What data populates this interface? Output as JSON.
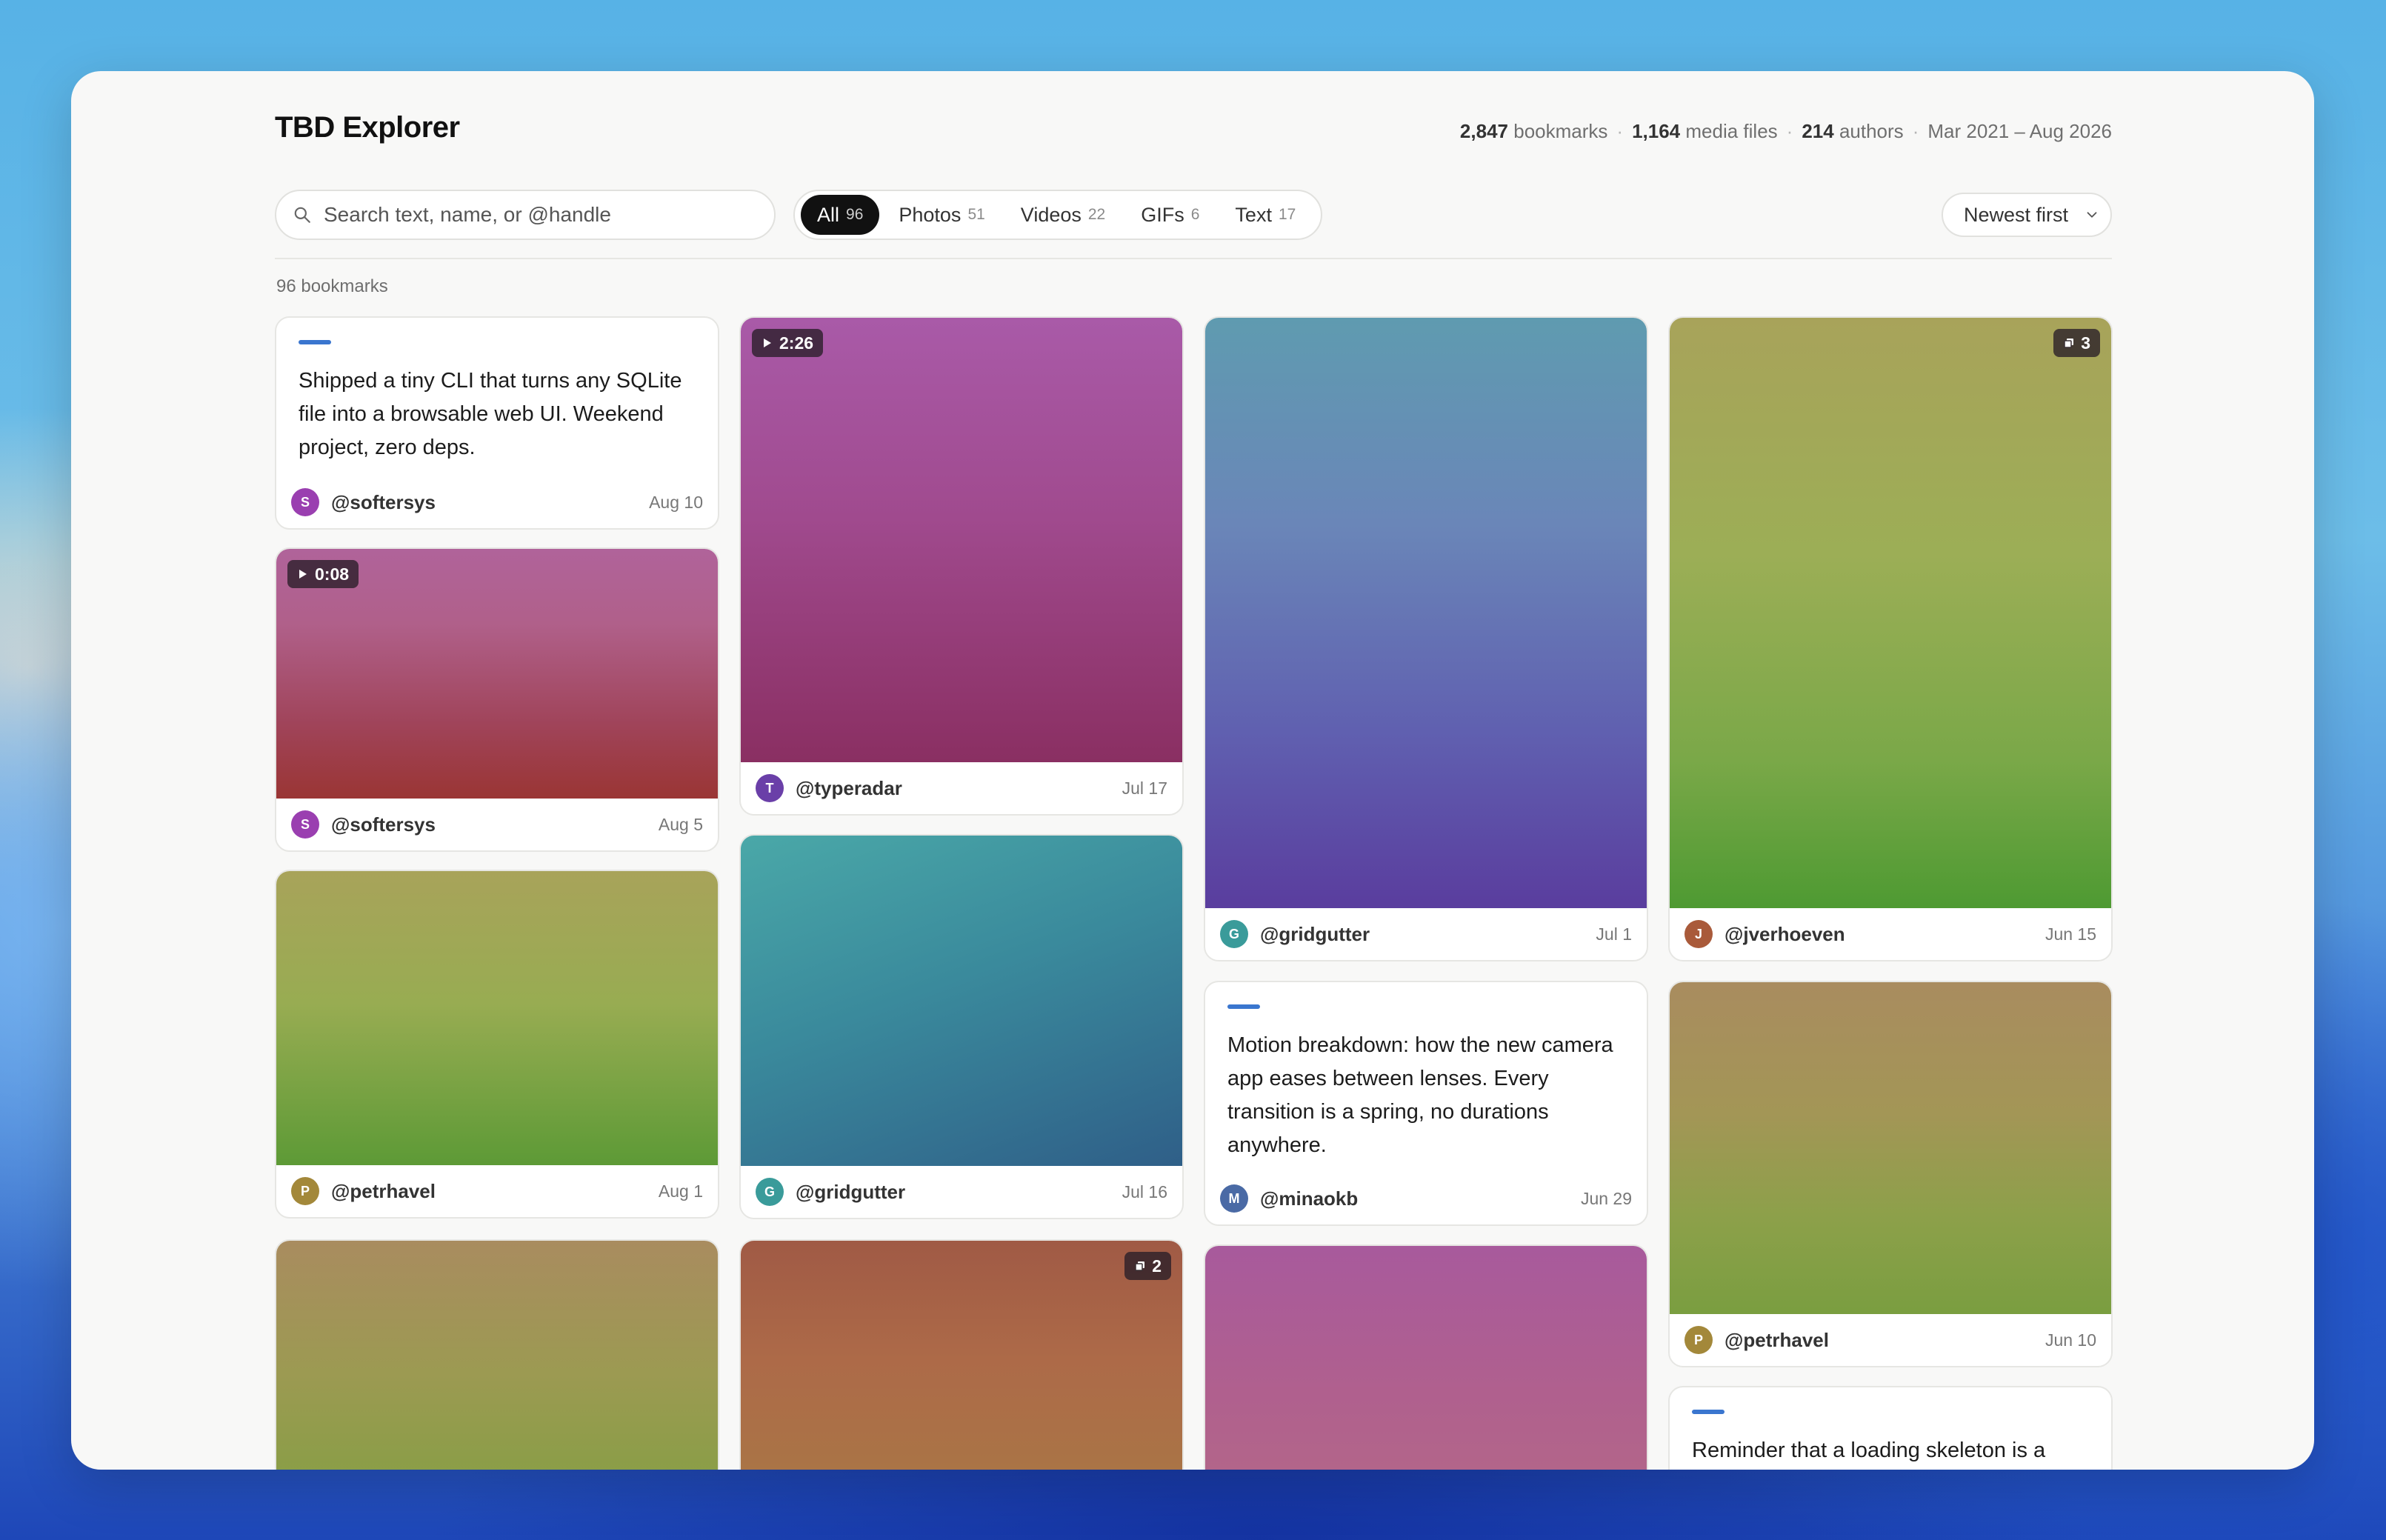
{
  "app": {
    "title": "TBD Explorer"
  },
  "stats": {
    "bookmarks_num": "2,847",
    "bookmarks_label": "bookmarks",
    "media_num": "1,164",
    "media_label": "media files",
    "authors_num": "214",
    "authors_label": "authors",
    "range": "Mar 2021 – Aug 2026",
    "separator": "·"
  },
  "search": {
    "placeholder": "Search text, name, or @handle",
    "icon": "search-icon"
  },
  "filters": [
    {
      "label": "All",
      "count": "96",
      "active": true
    },
    {
      "label": "Photos",
      "count": "51",
      "active": false
    },
    {
      "label": "Videos",
      "count": "22",
      "active": false
    },
    {
      "label": "GIFs",
      "count": "6",
      "active": false
    },
    {
      "label": "Text",
      "count": "17",
      "active": false
    }
  ],
  "sort": {
    "label": "Newest first",
    "icon": "chevron-down-icon"
  },
  "results": {
    "label": "96 bookmarks"
  },
  "colors": {
    "accent": "#3a76cf",
    "active_pill": "#111111",
    "avatar_s": "#9a3fb0",
    "avatar_t": "#6a3fa8",
    "avatar_g": "#3a9b9a",
    "avatar_j": "#a95a3a",
    "avatar_p": "#a3883a",
    "avatar_m": "#4a6aa5"
  },
  "cards": [
    {
      "type": "text",
      "text": "Shipped a tiny CLI that turns any SQLite file into a browsable web UI. Weekend project, zero deps.",
      "initial": "S",
      "handle": "@softersys",
      "date": "Aug 10"
    },
    {
      "type": "video",
      "duration": "0:08",
      "initial": "S",
      "handle": "@softersys",
      "date": "Aug 5"
    },
    {
      "type": "photo",
      "initial": "P",
      "handle": "@petrhavel",
      "date": "Aug 1"
    },
    {
      "type": "photo"
    },
    {
      "type": "video",
      "duration": "2:26",
      "initial": "T",
      "handle": "@typeradar",
      "date": "Jul 17"
    },
    {
      "type": "photo",
      "initial": "G",
      "handle": "@gridgutter",
      "date": "Jul 16"
    },
    {
      "type": "photo",
      "multi": "2"
    },
    {
      "type": "photo",
      "initial": "G",
      "handle": "@gridgutter",
      "date": "Jul 1"
    },
    {
      "type": "text",
      "text": "Motion breakdown: how the new camera app eases between lenses. Every transition is a spring, no durations anywhere.",
      "initial": "M",
      "handle": "@minaokb",
      "date": "Jun 29"
    },
    {
      "type": "photo"
    },
    {
      "type": "photo",
      "multi": "3",
      "initial": "J",
      "handle": "@jverhoeven",
      "date": "Jun 15"
    },
    {
      "type": "photo",
      "initial": "P",
      "handle": "@petrhavel",
      "date": "Jun 10"
    },
    {
      "type": "text",
      "text": "Reminder that a loading skeleton is a"
    }
  ]
}
